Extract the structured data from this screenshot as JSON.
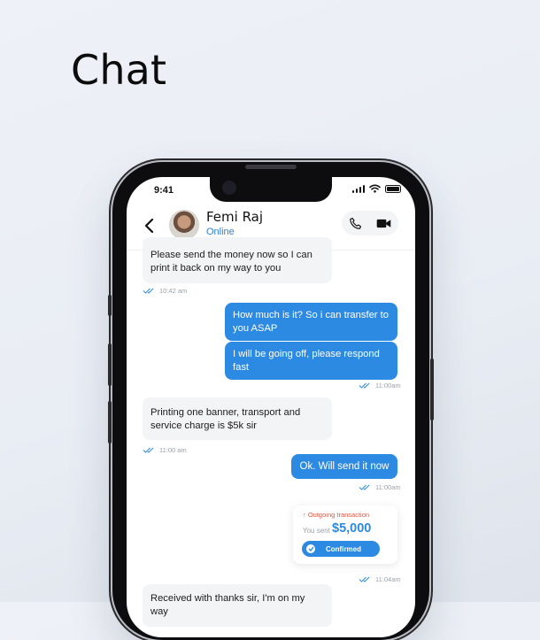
{
  "page": {
    "heading": "Chat"
  },
  "status_bar": {
    "time": "9:41"
  },
  "contact": {
    "name": "Femi Raj",
    "status": "Online"
  },
  "messages": [
    {
      "direction": "in",
      "text": "Please send the money now so I can print it back on my way to you",
      "time": "10:42 am"
    },
    {
      "direction": "out",
      "text": "How much is it? So i can transfer to you ASAP"
    },
    {
      "direction": "out",
      "text": "I will be going off, please respond fast",
      "time": "11:00am"
    },
    {
      "direction": "in",
      "text": "Printing one banner, transport and service charge is $5k sir",
      "time": "11:00 am"
    },
    {
      "direction": "out",
      "text": "Ok. Will send it now",
      "time": "11:00am"
    },
    {
      "direction": "in",
      "text": "Received with thanks sir, I'm on my way"
    }
  ],
  "transaction": {
    "label": "Outgoing transaction",
    "sent_label": "You sent",
    "amount": "$5,000",
    "status": "Confirmed",
    "time": "11:04am"
  },
  "colors": {
    "accent": "#2c8ae2",
    "incoming_bubble": "#f3f4f6",
    "alert": "#e2533c"
  },
  "icons": [
    "back-chevron-icon",
    "phone-icon",
    "video-camera-icon",
    "double-check-icon",
    "check-circle-icon",
    "arrow-up-icon"
  ]
}
